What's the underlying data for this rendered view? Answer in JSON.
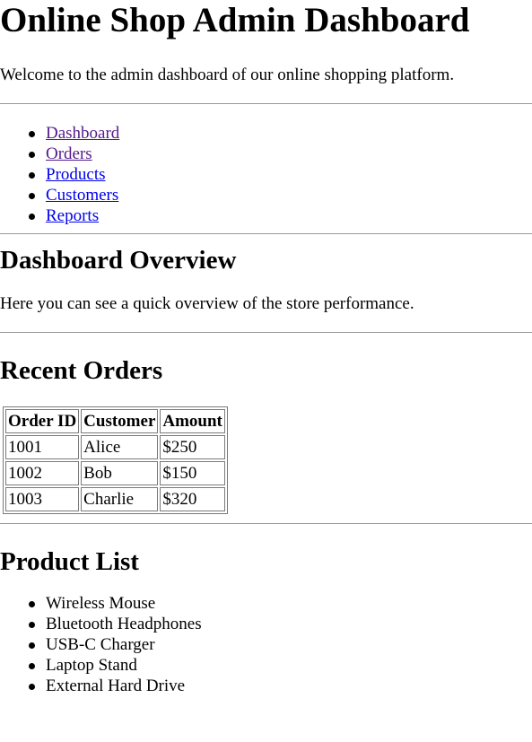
{
  "header": {
    "title": "Online Shop Admin Dashboard",
    "welcome": "Welcome to the admin dashboard of our online shopping platform."
  },
  "nav": {
    "items": [
      {
        "label": "Dashboard",
        "visited": true
      },
      {
        "label": "Orders",
        "visited": true
      },
      {
        "label": "Products",
        "visited": false
      },
      {
        "label": "Customers",
        "visited": false
      },
      {
        "label": "Reports",
        "visited": false
      }
    ]
  },
  "overview": {
    "title": "Dashboard Overview",
    "text": "Here you can see a quick overview of the store performance."
  },
  "orders": {
    "title": "Recent Orders",
    "columns": [
      "Order ID",
      "Customer",
      "Amount"
    ],
    "rows": [
      [
        "1001",
        "Alice",
        "$250"
      ],
      [
        "1002",
        "Bob",
        "$150"
      ],
      [
        "1003",
        "Charlie",
        "$320"
      ]
    ]
  },
  "products": {
    "title": "Product List",
    "items": [
      "Wireless Mouse",
      "Bluetooth Headphones",
      "USB-C Charger",
      "Laptop Stand",
      "External Hard Drive"
    ]
  },
  "colors": {
    "link": "#0000ee",
    "visited_link": "#551a8b",
    "rule": "#9a9a9a"
  }
}
